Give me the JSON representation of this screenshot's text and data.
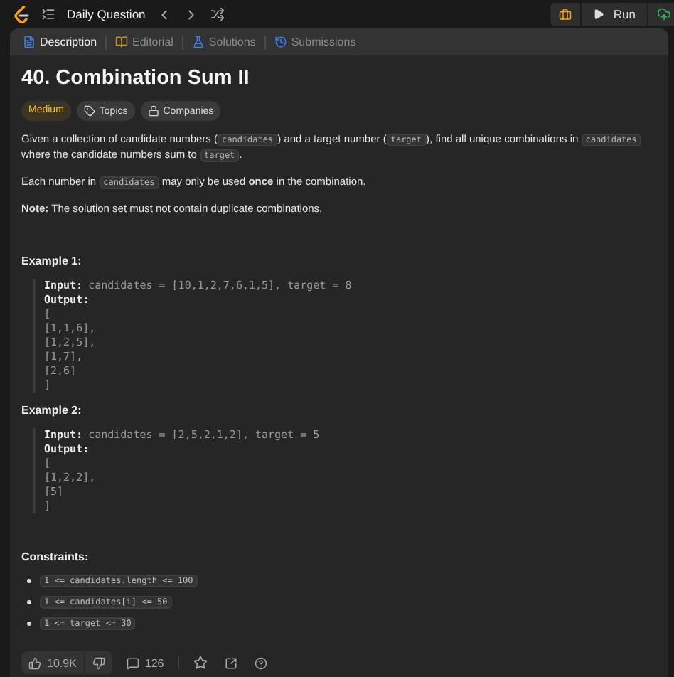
{
  "topbar": {
    "title": "Daily Question",
    "run": "Run"
  },
  "tabs": [
    {
      "label": "Description",
      "selected": true,
      "kind": "doc"
    },
    {
      "label": "Editorial",
      "selected": false,
      "kind": "book"
    },
    {
      "label": "Solutions",
      "selected": false,
      "kind": "flask"
    },
    {
      "label": "Submissions",
      "selected": false,
      "kind": "history"
    }
  ],
  "problem": {
    "title": "40. Combination Sum II",
    "difficulty": "Medium",
    "tags": [
      {
        "label": "Topics",
        "kind": "tag"
      },
      {
        "label": "Companies",
        "kind": "lock"
      }
    ],
    "paragraphs": [
      [
        {
          "t": "Given a collection of candidate numbers ("
        },
        {
          "t": "candidates",
          "code": true
        },
        {
          "t": ") and a target number ("
        },
        {
          "t": "target",
          "code": true
        },
        {
          "t": "), find all unique combinations in "
        },
        {
          "t": "candidates",
          "code": true
        },
        {
          "t": " where the candidate numbers sum to "
        },
        {
          "t": "target",
          "code": true
        },
        {
          "t": "."
        }
      ],
      [
        {
          "t": "Each number in "
        },
        {
          "t": "candidates",
          "code": true
        },
        {
          "t": " may only be used **once** in the combination."
        }
      ],
      [
        {
          "t": "**Note:** The solution set must not contain duplicate combinations."
        }
      ]
    ],
    "examples": [
      {
        "heading": "Example 1:",
        "input_label": "Input:",
        "input": "candidates = [10,1,2,7,6,1,5], target = 8",
        "output_label": "Output:",
        "output": [
          "[",
          "[1,1,6],",
          "[1,2,5],",
          "[1,7],",
          "[2,6]",
          "]"
        ]
      },
      {
        "heading": "Example 2:",
        "input_label": "Input:",
        "input": "candidates = [2,5,2,1,2], target = 5",
        "output_label": "Output:",
        "output": [
          "[",
          "[1,2,2],",
          "[5]",
          "]"
        ]
      }
    ],
    "constraints_heading": "Constraints:",
    "constraints": [
      "1 <= candidates.length <= 100",
      "1 <= candidates[i] <= 50",
      "1 <= target <= 30"
    ]
  },
  "footer": {
    "likes": "10.9K",
    "comments": "126"
  }
}
